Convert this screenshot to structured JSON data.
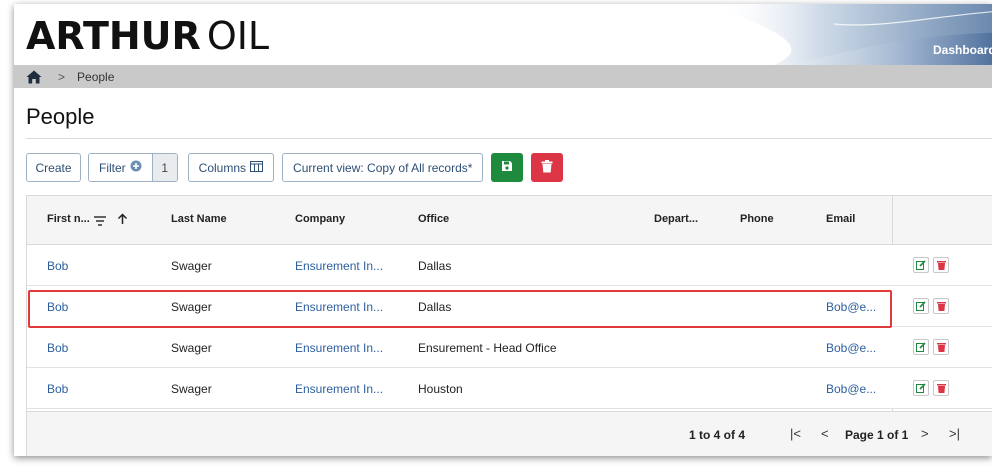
{
  "header": {
    "logo_bold": "ARTHUR",
    "logo_light": "OIL",
    "dashboard_link": "Dashboard"
  },
  "breadcrumb": {
    "separator": ">",
    "current": "People"
  },
  "page": {
    "title": "People"
  },
  "toolbar": {
    "create_label": "Create",
    "filter_label": "Filter",
    "filter_count": "1",
    "columns_label": "Columns",
    "view_label": "Current view: Copy of All records*",
    "save_color": "#1e8a3d",
    "delete_color": "#dc3545"
  },
  "grid": {
    "columns": [
      "First n...",
      "Last Name",
      "Company",
      "Office",
      "Depart...",
      "Phone",
      "Email"
    ],
    "sort_indicator": "ascending",
    "rows": [
      {
        "first": "Bob",
        "last": "Swager",
        "company": "Ensurement In...",
        "office": "Dallas",
        "department": "",
        "phone": "",
        "email": ""
      },
      {
        "first": "Bob",
        "last": "Swager",
        "company": "Ensurement In...",
        "office": "Dallas",
        "department": "",
        "phone": "",
        "email": "Bob@e..."
      },
      {
        "first": "Bob",
        "last": "Swager",
        "company": "Ensurement In...",
        "office": "Ensurement - Head Office",
        "department": "",
        "phone": "",
        "email": "Bob@e..."
      },
      {
        "first": "Bob",
        "last": "Swager",
        "company": "Ensurement In...",
        "office": "Houston",
        "department": "",
        "phone": "",
        "email": "Bob@e..."
      }
    ],
    "highlighted_row": 2
  },
  "pagination": {
    "summary": "1 to 4 of 4",
    "first": "|<",
    "prev": "<",
    "page_label": "Page 1 of 1",
    "next": ">",
    "last": ">|"
  }
}
